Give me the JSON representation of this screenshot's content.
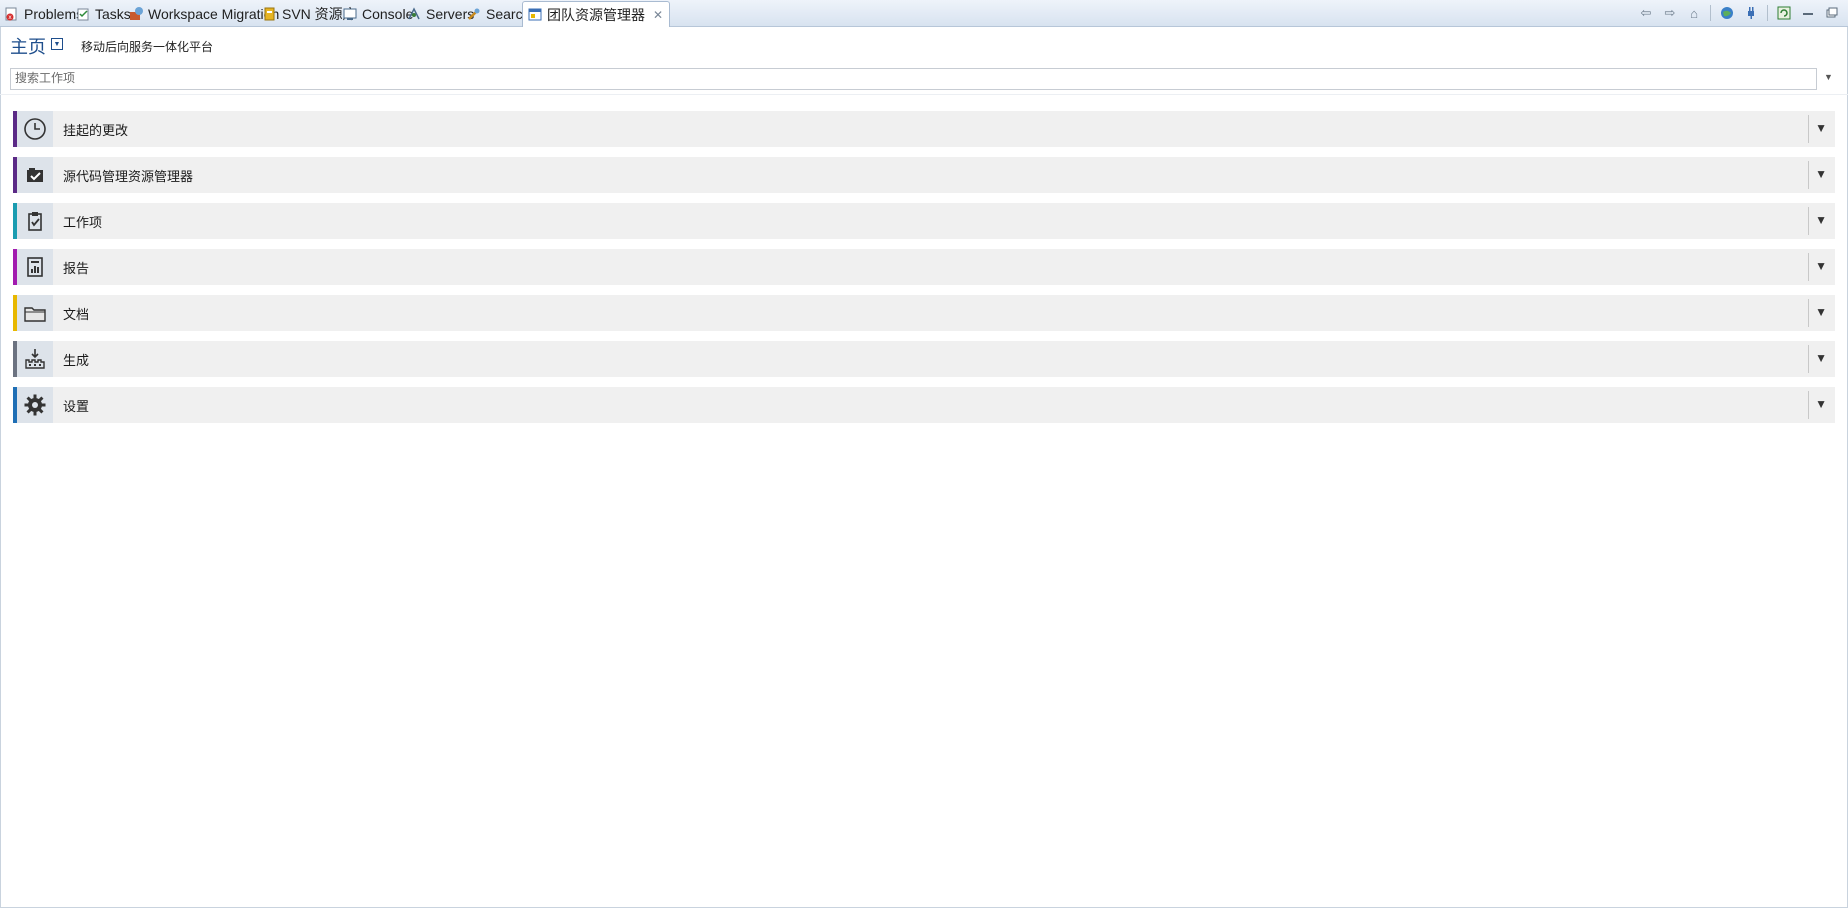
{
  "tabs": [
    {
      "label": "Problems",
      "icon": "problems-icon"
    },
    {
      "label": "Tasks",
      "icon": "tasks-icon"
    },
    {
      "label": "Workspace Migration",
      "icon": "migration-icon"
    },
    {
      "label": "SVN 资源库",
      "icon": "svn-icon"
    },
    {
      "label": "Console",
      "icon": "console-icon"
    },
    {
      "label": "Servers",
      "icon": "servers-icon"
    },
    {
      "label": "Search",
      "icon": "search-icon"
    },
    {
      "label": "团队资源管理器",
      "icon": "team-explorer-icon",
      "active": true
    }
  ],
  "toolbar_icons": [
    "back-icon",
    "forward-icon",
    "home-icon",
    "globe-icon",
    "plug-icon",
    "refresh-icon",
    "minimize-icon",
    "maximize-icon"
  ],
  "header": {
    "title": "主页",
    "project": "移动后向服务一体化平台"
  },
  "search": {
    "placeholder": "搜索工作项",
    "value": ""
  },
  "sections": [
    {
      "label": "挂起的更改",
      "icon": "clock-icon",
      "color": "#5b2a86"
    },
    {
      "label": "源代码管理资源管理器",
      "icon": "source-control-icon",
      "color": "#5b2a86"
    },
    {
      "label": "工作项",
      "icon": "clipboard-check-icon",
      "color": "#1a9cb0"
    },
    {
      "label": "报告",
      "icon": "report-icon",
      "color": "#a21caf"
    },
    {
      "label": "文档",
      "icon": "folder-icon",
      "color": "#e8b800"
    },
    {
      "label": "生成",
      "icon": "build-icon",
      "color": "#6b7280"
    },
    {
      "label": "设置",
      "icon": "gear-icon",
      "color": "#1f6fb5"
    }
  ]
}
